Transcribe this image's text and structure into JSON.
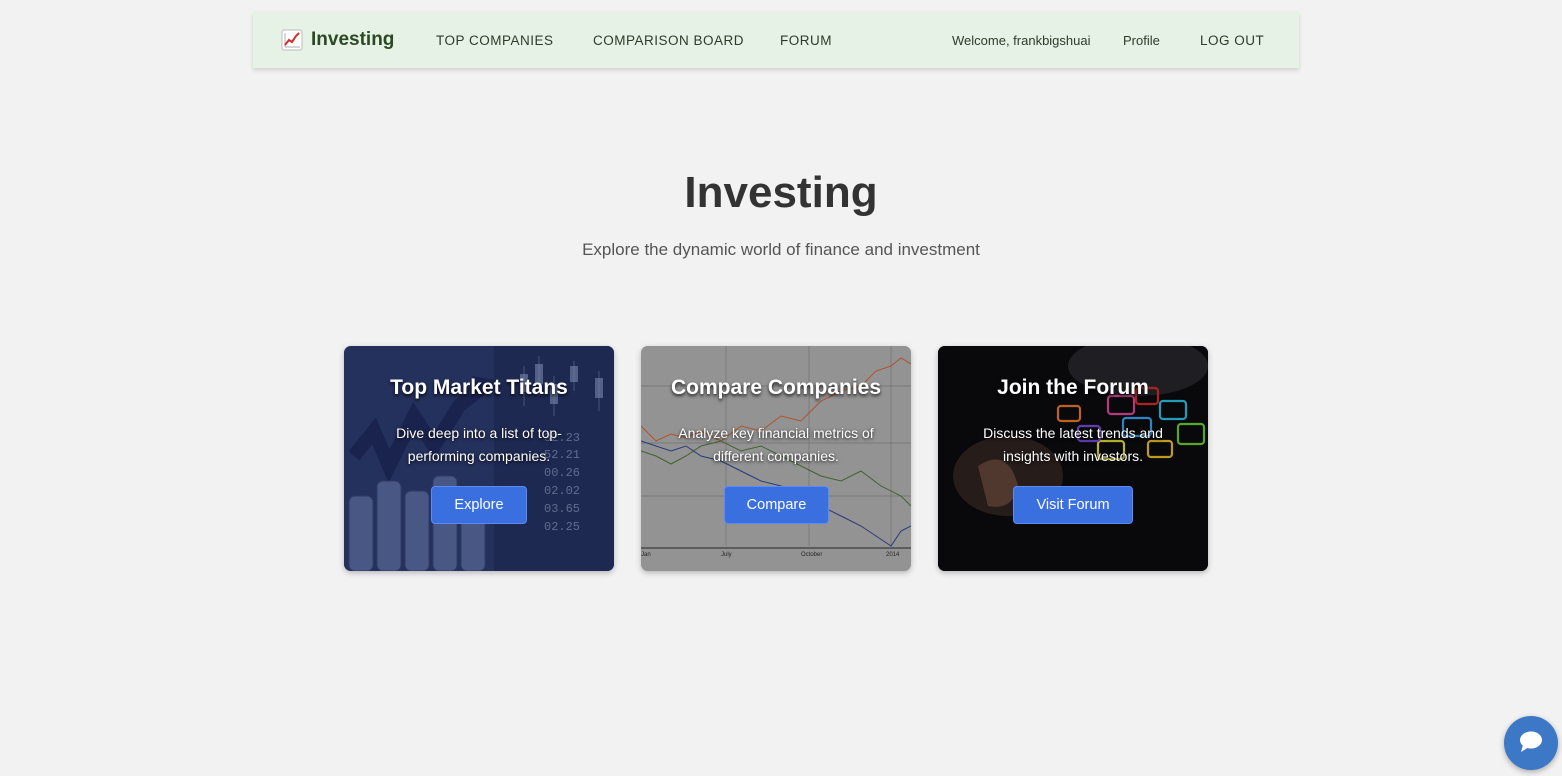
{
  "nav": {
    "brand": "Investing",
    "brand_icon": "chart-increasing-icon",
    "top_companies": "TOP COMPANIES",
    "comparison_board": "COMPARISON BOARD",
    "forum": "FORUM",
    "welcome": "Welcome, frankbigshuai",
    "profile": "Profile",
    "logout": "LOG OUT"
  },
  "hero": {
    "title": "Investing",
    "subtitle": "Explore the dynamic world of finance and investment"
  },
  "cards": [
    {
      "title": "Top Market Titans",
      "description": "Dive deep into a list of top-performing companies.",
      "button": "Explore",
      "image_icon": "stock-chart-image"
    },
    {
      "title": "Compare Companies",
      "description": "Analyze key financial metrics of different companies.",
      "button": "Compare",
      "image_icon": "line-chart-image"
    },
    {
      "title": "Join the Forum",
      "description": "Discuss the latest trends and insights with investors.",
      "button": "Visit Forum",
      "image_icon": "chat-bubbles-image"
    }
  ],
  "chat": {
    "icon": "chat-bubble-icon"
  },
  "colors": {
    "navbar_bg": "#e6f2e6",
    "button_blue": "#3a6fe0",
    "chat_blue": "#3d78c7",
    "page_bg": "#f2f2f2"
  }
}
